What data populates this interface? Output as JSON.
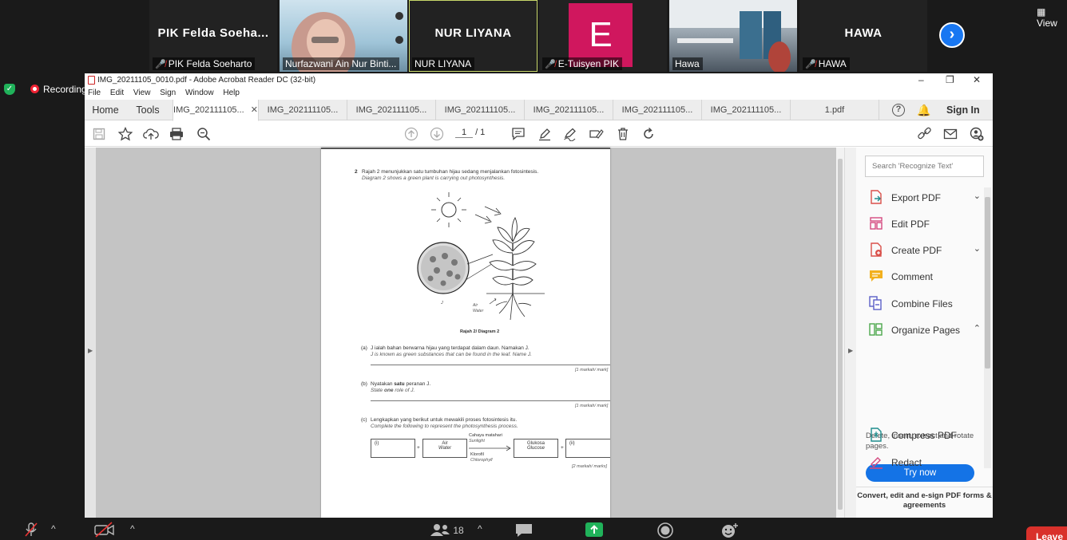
{
  "zoom": {
    "participants": [
      {
        "big_name": "PIK  Felda  Soeha...",
        "caption": "PIK Felda Soeharto",
        "muted": true
      },
      {
        "big_name": "",
        "caption": "Nurfazwani Ain Nur Binti...",
        "muted": false
      },
      {
        "big_name": "NUR LIYANA",
        "caption": "NUR LIYANA",
        "muted": false
      },
      {
        "big_name": "E",
        "caption": "E-Tuisyen PIK",
        "muted": true
      },
      {
        "big_name": "",
        "caption": "Hawa",
        "muted": false
      },
      {
        "big_name": "HAWA",
        "caption": "HAWA",
        "muted": true
      }
    ],
    "view_label": "View",
    "recording_label": "Recording",
    "participant_count": "18",
    "leave_label": "Leave",
    "colors": {
      "accent": "#1877f2",
      "avatar": "#d0175e",
      "leave": "#d9312b",
      "share": "#20b25a"
    }
  },
  "acrobat": {
    "window_title": "IMG_20211105_0010.pdf - Adobe Acrobat Reader DC (32-bit)",
    "menu": [
      "File",
      "Edit",
      "View",
      "Sign",
      "Window",
      "Help"
    ],
    "nav_tabs": [
      "Home",
      "Tools"
    ],
    "doc_tabs": [
      "IMG_202111105...",
      "IMG_202111105...",
      "IMG_202111105...",
      "IMG_202111105...",
      "IMG_202111105...",
      "IMG_202111105...",
      "IMG_202111105...",
      "1.pdf"
    ],
    "help_label": "?",
    "sign_in": "Sign In",
    "page_current": "1",
    "page_total": "/  1",
    "right_panel": {
      "search_placeholder": "Search 'Recognize Text'",
      "tools": [
        {
          "label": "Export PDF",
          "chevron": "down"
        },
        {
          "label": "Edit PDF",
          "chevron": ""
        },
        {
          "label": "Create PDF",
          "chevron": "down"
        },
        {
          "label": "Comment",
          "chevron": ""
        },
        {
          "label": "Combine Files",
          "chevron": ""
        },
        {
          "label": "Organize Pages",
          "chevron": "up"
        },
        {
          "label": "Compress PDF",
          "chevron": ""
        },
        {
          "label": "Redact",
          "chevron": ""
        }
      ],
      "organize_desc": "Delete, insert, extract and rotate pages.",
      "try_now": "Try now",
      "footer": "Convert, edit and e-sign PDF forms & agreements"
    },
    "document": {
      "q_number": "2",
      "q_text_ms": "Rajah 2 menunjukkan satu tumbuhan hijau sedang menjalankan fotosintesis.",
      "q_text_en": "Diagram 2 shows a green plant is carrying out photosynthesis.",
      "label_j": "J",
      "label_air": "Air",
      "label_water": "Water",
      "diagram_caption": "Rajah 2/ Diagram 2",
      "a_label": "(a)",
      "a_ms": "J ialah bahan berwarna hijau yang terdapat dalam daun. Namakan J.",
      "a_en": "J is known as green substances that can be found in the leaf. Name J.",
      "a_marks": "[1 markah/ mark]",
      "b_label": "(b)",
      "b_ms_pre": "Nyatakan ",
      "b_ms_bold": "satu",
      "b_ms_post": " peranan J.",
      "b_en_pre": "State ",
      "b_en_bold": "one",
      "b_en_post": " role of J.",
      "b_marks": "[1 markah/ mark]",
      "c_label": "(c)",
      "c_ms": "Lengkapkan yang berikut untuk mewakili proses fotosintesis itu.",
      "c_en": "Complete the following to represent the photosynthesis process.",
      "eq_i": "(i)",
      "eq_plus1": "+",
      "eq_air": "Air",
      "eq_water": "Water",
      "eq_sun_ms": "Cahaya matahari",
      "eq_sun_en": "Sunlight",
      "eq_chl_ms": "Klorofil",
      "eq_chl_en": "Chlorophyll",
      "eq_glukosa": "Glukosa",
      "eq_glucose": "Glucose",
      "eq_plus2": "+",
      "eq_ii": "(ii)",
      "c_marks": "[2 markah/ marks]"
    }
  }
}
